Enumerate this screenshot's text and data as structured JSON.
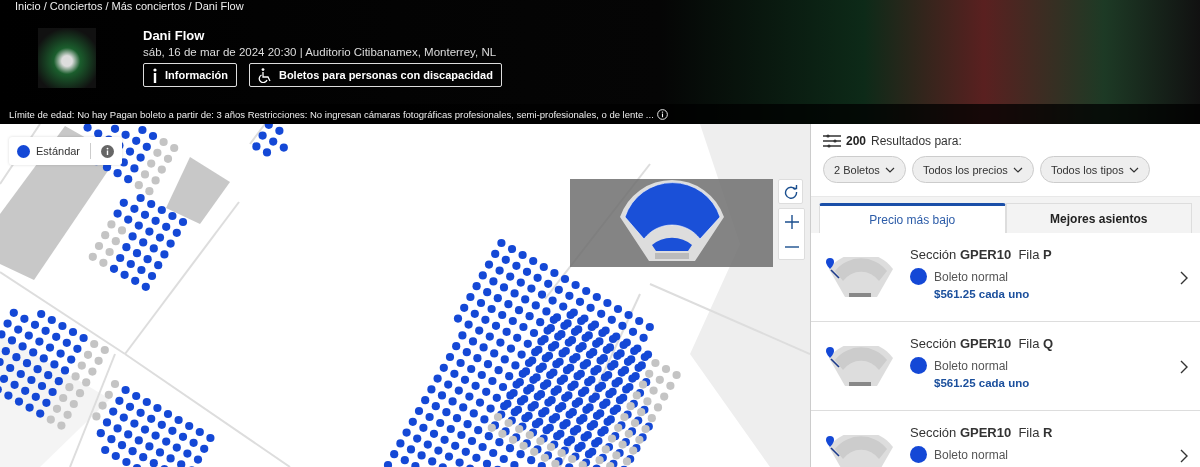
{
  "breadcrumb": "Inicio / Conciertos / Más conciertos / Dani Flow",
  "event": {
    "title": "Dani Flow",
    "datetime": "sáb, 16 de mar de 2024 20:30 | Auditorio Citibanamex, Monterrey, NL",
    "buttons": [
      {
        "label": "Información",
        "kind": "info"
      },
      {
        "label": "Boletos para personas con discapacidad",
        "kind": "accessibility"
      }
    ],
    "notice": "Límite de edad: No hay Pagan boleto a partir de: 3 años Restricciones: No ingresan cámaras fotográficas profesionales, semi-profesionales, o de lente ..."
  },
  "legend": [
    {
      "label": "Estándar",
      "color": "#1448d6"
    }
  ],
  "results": {
    "count": "200",
    "label": "Resultados para:",
    "filters": [
      "2 Boletos",
      "Todos los precios",
      "Todos los tipos"
    ],
    "tabs": [
      {
        "label": "Precio más bajo",
        "selected": true
      },
      {
        "label": "Mejores asientos",
        "selected": false
      }
    ],
    "listings": [
      {
        "title": "Sección **GPER10**  Fila **P**",
        "type": "Boleto normal",
        "color": "#1448d6",
        "price": "$561.25 cada uno"
      },
      {
        "title": "Sección **GPER10**  Fila **Q**",
        "type": "Boleto normal",
        "color": "#1448d6",
        "price": "$561.25 cada uno"
      },
      {
        "title": "Sección **GPER10**  Fila **R**",
        "type": "Boleto normal",
        "color": "#1448d6"
      }
    ]
  }
}
